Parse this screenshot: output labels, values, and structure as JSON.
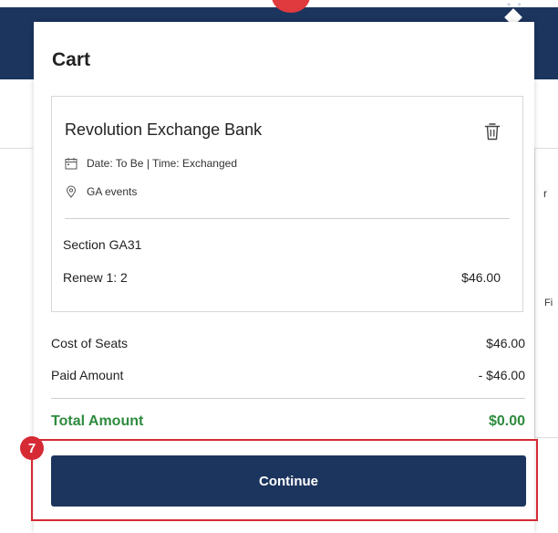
{
  "cart": {
    "title": "Cart",
    "item": {
      "event_name": "Revolution Exchange Bank",
      "date_time": "Date: To Be | Time: Exchanged",
      "venue": "GA events",
      "section": "Section GA31",
      "line_label": "Renew 1: 2",
      "line_price": "$46.00"
    },
    "summary": {
      "cost_label": "Cost of Seats",
      "cost_value": "$46.00",
      "paid_label": "Paid Amount",
      "paid_value": "- $46.00",
      "total_label": "Total Amount",
      "total_value": "$0.00"
    },
    "continue_label": "Continue"
  },
  "annotation": {
    "step_number": "7"
  },
  "background": {
    "partial_text_1": "r",
    "partial_text_2": "Fi"
  },
  "colors": {
    "navy": "#1c355e",
    "total_green": "#2e8b3e",
    "highlight_red": "#d62a34"
  },
  "icons": [
    "calendar-icon",
    "location-pin-icon",
    "trash-icon"
  ]
}
